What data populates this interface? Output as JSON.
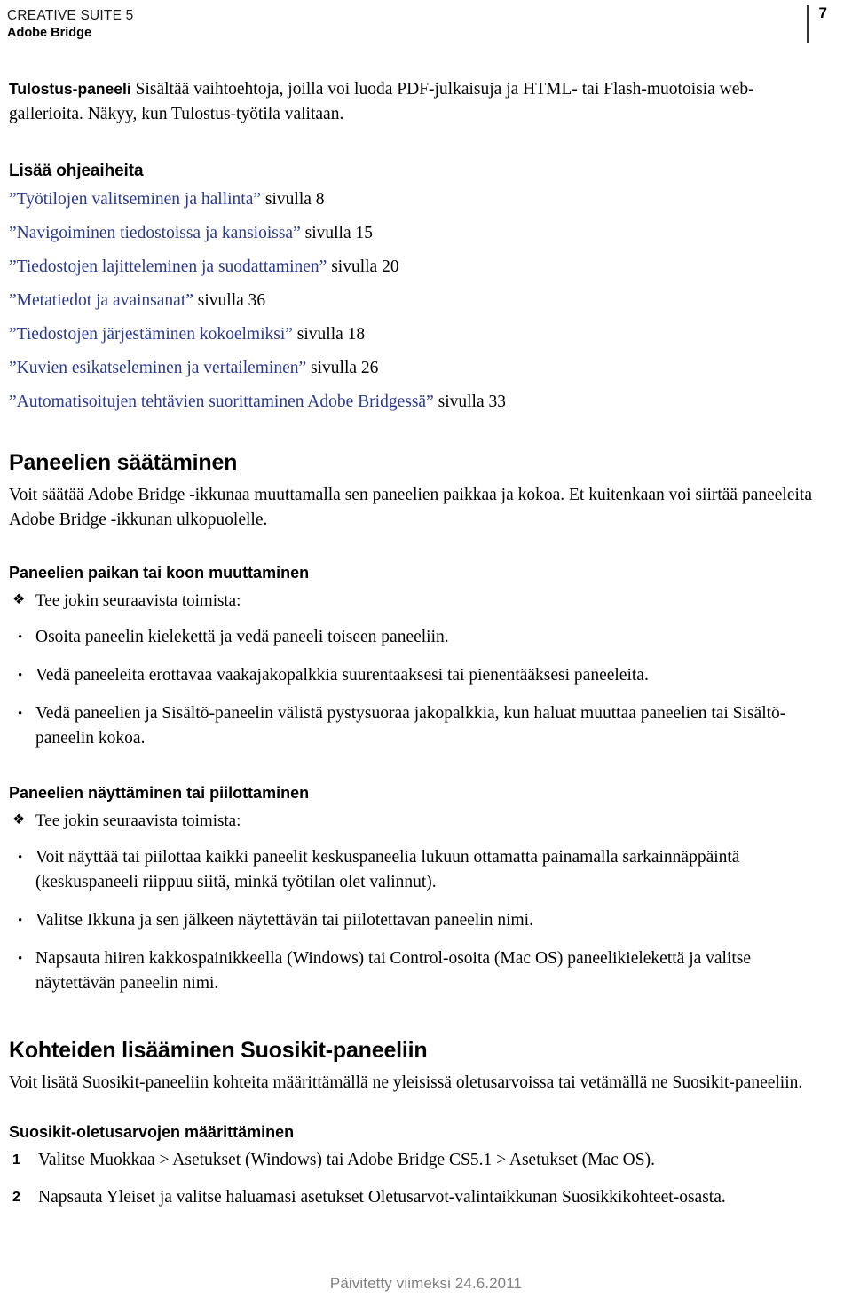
{
  "header": {
    "suite": "CREATIVE SUITE 5",
    "product": "Adobe Bridge",
    "page_number": "7"
  },
  "intro": {
    "term": "Tulostus-paneeli",
    "text": " Sisältää vaihtoehtoja, joilla voi luoda PDF-julkaisuja ja HTML- tai Flash-muotoisia web-gallerioita. Näkyy, kun Tulostus-työtila valitaan."
  },
  "more_topics": {
    "heading": "Lisää ohjeaiheita",
    "items": [
      {
        "link": "”Työtilojen valitseminen ja hallinta”",
        "suffix": " sivulla 8"
      },
      {
        "link": "”Navigoiminen tiedostoissa ja kansioissa”",
        "suffix": " sivulla 15"
      },
      {
        "link": "”Tiedostojen lajitteleminen ja suodattaminen”",
        "suffix": " sivulla 20"
      },
      {
        "link": "”Metatiedot ja avainsanat”",
        "suffix": " sivulla 36"
      },
      {
        "link": "”Tiedostojen järjestäminen kokoelmiksi”",
        "suffix": " sivulla 18"
      },
      {
        "link": "”Kuvien esikatseleminen ja vertaileminen”",
        "suffix": " sivulla 26"
      },
      {
        "link": "”Automatisoitujen tehtävien suorittaminen Adobe Bridgessä”",
        "suffix": " sivulla 33"
      }
    ]
  },
  "panels_adjust": {
    "heading": "Paneelien säätäminen",
    "body": "Voit säätää Adobe Bridge -ikkunaa muuttamalla sen paneelien paikkaa ja kokoa. Et kuitenkaan voi siirtää paneeleita Adobe Bridge -ikkunan ulkopuolelle."
  },
  "panel_move": {
    "heading": "Paneelien paikan tai koon muuttaminen",
    "procedure": "Tee jokin seuraavista toimista:",
    "bullets": [
      "Osoita paneelin kielekettä ja vedä paneeli toiseen paneeliin.",
      "Vedä paneeleita erottavaa vaakajakopalkkia suurentaaksesi tai pienentääksesi paneeleita.",
      "Vedä paneelien ja Sisältö-paneelin välistä pystysuoraa jakopalkkia, kun haluat muuttaa paneelien tai Sisältö-paneelin kokoa."
    ]
  },
  "panel_show_hide": {
    "heading": "Paneelien näyttäminen tai piilottaminen",
    "procedure": "Tee jokin seuraavista toimista:",
    "bullets": [
      "Voit näyttää tai piilottaa kaikki paneelit keskuspaneelia lukuun ottamatta painamalla sarkainnäppäintä (keskuspaneeli riippuu siitä, minkä työtilan olet valinnut).",
      "Valitse Ikkuna ja sen jälkeen näytettävän tai piilotettavan paneelin nimi.",
      "Napsauta hiiren kakkospainikkeella (Windows) tai Control-osoita (Mac OS) paneelikielekettä ja valitse näytettävän paneelin nimi."
    ]
  },
  "favorites": {
    "heading": "Kohteiden lisääminen Suosikit-paneeliin",
    "body": "Voit lisätä Suosikit-paneeliin kohteita määrittämällä ne yleisissä oletusarvoissa tai vetämällä ne Suosikit-paneeliin."
  },
  "favorites_defaults": {
    "heading": "Suosikit-oletusarvojen määrittäminen",
    "steps": [
      {
        "number": "1",
        "text": "Valitse Muokkaa > Asetukset (Windows) tai Adobe Bridge CS5.1 > Asetukset (Mac OS)."
      },
      {
        "number": "2",
        "text": "Napsauta Yleiset ja valitse haluamasi asetukset Oletusarvot-valintaikkunan Suosikkikohteet-osasta."
      }
    ]
  },
  "footer": {
    "text": "Päivitetty viimeksi 24.6.2011"
  },
  "markers": {
    "procedure": "❖",
    "bullet": "•"
  },
  "colors": {
    "link": "#2b3990",
    "footer": "#808080",
    "rule": "#333333"
  }
}
